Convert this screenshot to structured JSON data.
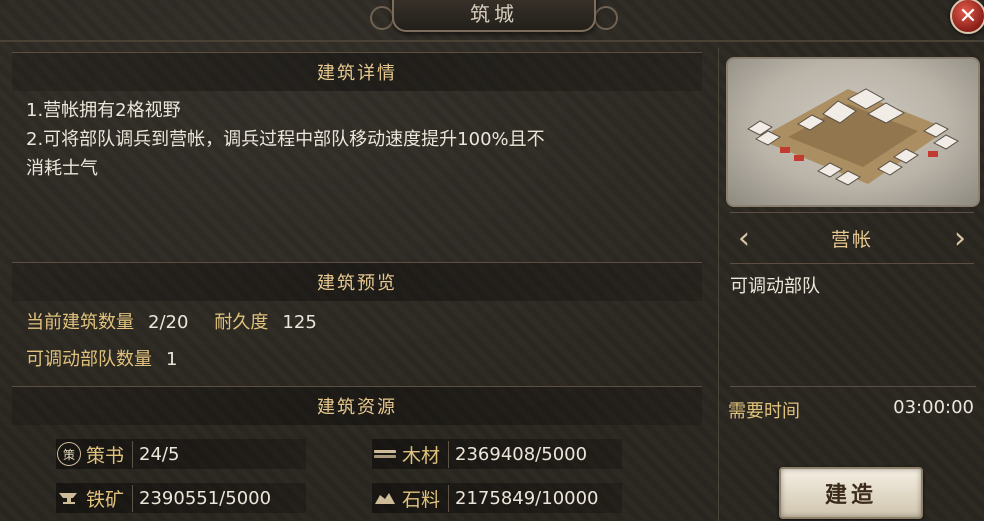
{
  "title": "筑城",
  "close_label": "✕",
  "details": {
    "header": "建筑详情",
    "lines": [
      "1.营帐拥有2格视野",
      "2.可将部队调兵到营帐，调兵过程中部队移动速度提升100%且不\n消耗士气"
    ]
  },
  "preview": {
    "header": "建筑预览",
    "stats": {
      "count_label": "当前建筑数量",
      "count_value": "2/20",
      "durability_label": "耐久度",
      "durability_value": "125",
      "troops_label": "可调动部队数量",
      "troops_value": "1"
    }
  },
  "resources": {
    "header": "建筑资源",
    "items": [
      {
        "icon": "book-seal-icon",
        "glyph": "策",
        "label": "策书",
        "value": "24/5"
      },
      {
        "icon": "wood-icon",
        "label": "木材",
        "value": "2369408/5000"
      },
      {
        "icon": "iron-anvil-icon",
        "label": "铁矿",
        "value": "2390551/5000"
      },
      {
        "icon": "stone-icon",
        "label": "石料",
        "value": "2175849/10000"
      }
    ]
  },
  "building": {
    "name": "营帐",
    "description": "可调动部队",
    "time_label": "需要时间",
    "time_value": "03:00:00",
    "build_label": "建造",
    "prev_arrow": "‹",
    "next_arrow": "›"
  },
  "colors": {
    "accent_gold": "#e0c27c",
    "header_gold": "#e6c88f",
    "text": "#ece6da",
    "close_red": "#b8342a"
  }
}
